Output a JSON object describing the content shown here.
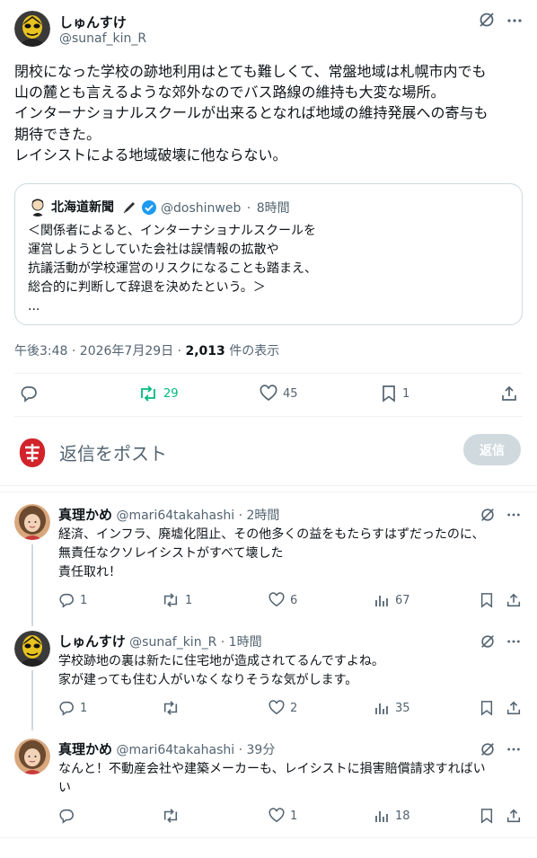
{
  "main_post": {
    "author_name": "しゅんすけ",
    "author_handle": "@sunaf_kin_R",
    "text_lines": [
      "閉校になった学校の跡地利用はとても難しくて、常盤地域は札幌市内でも",
      "山の麓とも言えるような郊外なのでバス路線の維持も大変な場所。",
      "インターナショナルスクールが出来るとなれば地域の維持発展への寄与も",
      "期待できた。",
      "レイシストによる地域破壊に他ならない。"
    ],
    "quote": {
      "name": "北海道新聞",
      "handle": "@doshinweb",
      "separator": "·",
      "time": "8時間",
      "body_lines": [
        "＜関係者によると、インターナショナルスクールを",
        "運営しようとしていた会社は誤情報の拡散や",
        "抗議活動が学校運営のリスクになることも踏まえ、",
        "総合的に判断して辞退を決めたという。＞",
        "..."
      ]
    },
    "timestamp": "午後3:48 · 2026年7月29日 · ",
    "views_count": "2,013",
    "views_label": " 件の表示",
    "actions": {
      "reposts": "29",
      "likes": "45",
      "bookmarks": "1"
    }
  },
  "composer": {
    "placeholder": "返信をポスト",
    "button_label": "返信"
  },
  "replies": [
    {
      "name": "真理かめ",
      "handle": "@mari64takahashi",
      "time": "· 2時間",
      "lines": [
        "経済、インフラ、廃墟化阻止、その他多くの益をもたらすはずだったのに、",
        "無責任なクソレイシストがすべて壊した",
        "責任取れ！"
      ],
      "replies": "1",
      "reposts": "1",
      "likes": "6",
      "views": "67"
    },
    {
      "name": "しゅんすけ",
      "handle": "@sunaf_kin_R",
      "time": "· 1時間",
      "lines": [
        "学校跡地の裏は新たに住宅地が造成されてるんですよね。",
        "家が建っても住む人がいなくなりそうな気がします。"
      ],
      "replies": "1",
      "reposts": "",
      "likes": "2",
      "views": "35"
    },
    {
      "name": "真理かめ",
      "handle": "@mari64takahashi",
      "time": "· 39分",
      "lines": [
        "なんと！不動産会社や建築メーカーも、レイシストに損害賠償請求すればい",
        "い"
      ],
      "replies": "",
      "reposts": "",
      "likes": "1",
      "views": "18"
    }
  ],
  "colors": {
    "repost_active": "#00ba7c",
    "verified": "#1d9bf0",
    "text_secondary": "#536471"
  }
}
